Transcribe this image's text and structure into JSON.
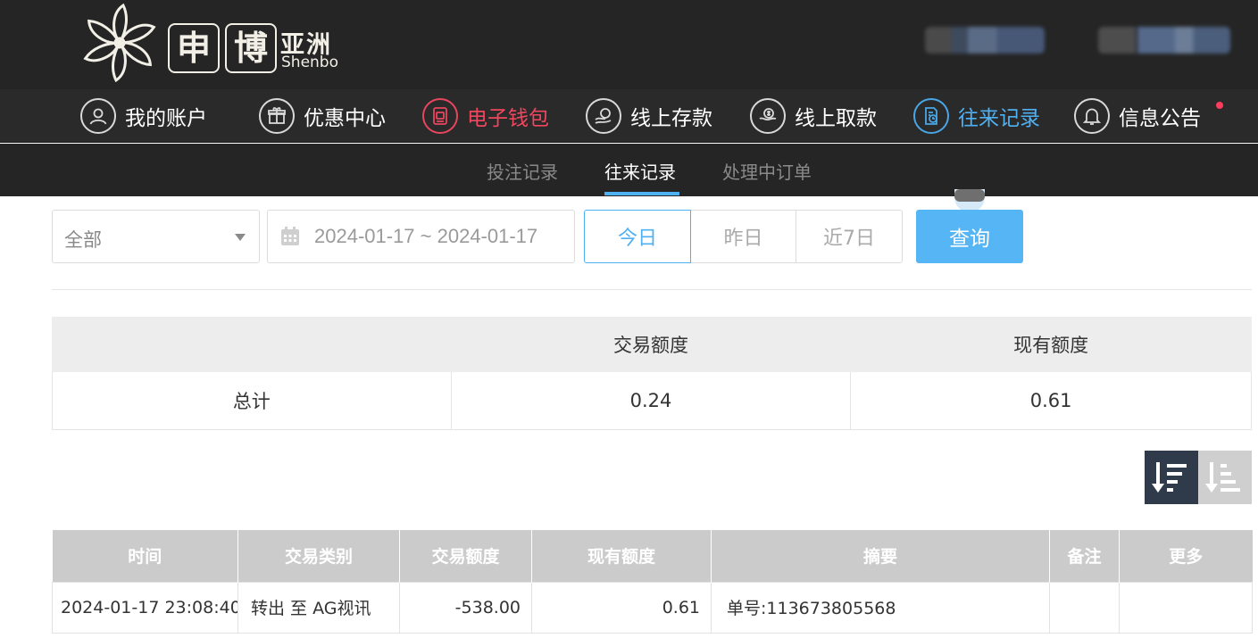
{
  "brand": {
    "box1": "申",
    "box2": "博",
    "cn": "亚洲",
    "en": "Shenbo"
  },
  "nav": [
    {
      "label": "我的账户",
      "icon": "user-icon"
    },
    {
      "label": "优惠中心",
      "icon": "gift-icon"
    },
    {
      "label": "电子钱包",
      "icon": "wallet-icon",
      "state": "highlight-red"
    },
    {
      "label": "线上存款",
      "icon": "deposit-icon"
    },
    {
      "label": "线上取款",
      "icon": "withdraw-icon"
    },
    {
      "label": "往来记录",
      "icon": "records-icon",
      "state": "active"
    },
    {
      "label": "信息公告",
      "icon": "bell-icon",
      "badge": true
    }
  ],
  "subnav": [
    {
      "label": "投注记录"
    },
    {
      "label": "往来记录",
      "active": true
    },
    {
      "label": "处理中订单"
    }
  ],
  "filters": {
    "type_select": "全部",
    "date_range": "2024-01-17 ~ 2024-01-17",
    "quick_ranges": [
      "今日",
      "昨日",
      "近7日"
    ],
    "selected_range": "今日",
    "query_label": "查询"
  },
  "summary": {
    "headers": [
      "",
      "交易额度",
      "现有额度"
    ],
    "row": [
      "总计",
      "0.24",
      "0.61"
    ]
  },
  "records": {
    "headers": [
      "时间",
      "交易类别",
      "交易额度",
      "现有额度",
      "摘要",
      "备注",
      "更多"
    ],
    "rows": [
      [
        "2024-01-17 23:08:40",
        "转出 至 AG视讯",
        "-538.00",
        "0.61",
        "单号:113673805568",
        "",
        ""
      ]
    ]
  },
  "colors": {
    "header_bg": "#252525",
    "accent_blue": "#4fb0f2",
    "accent_red": "#f0475f",
    "query_button": "#56b6f5",
    "sort_active": "#2f3a4b",
    "table_header": "#cbcbcb"
  }
}
